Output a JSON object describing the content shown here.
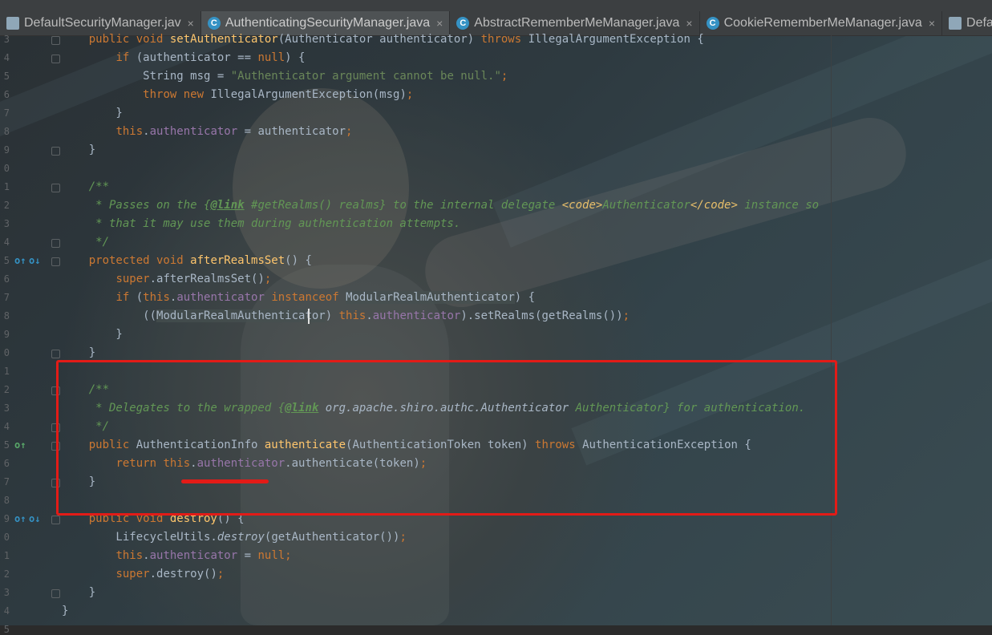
{
  "tabs": [
    {
      "label": "DefaultSecurityManager.jav",
      "icon": "doc-icon",
      "active": false
    },
    {
      "label": "AuthenticatingSecurityManager.java",
      "icon": "class-icon",
      "active": true
    },
    {
      "label": "AbstractRememberMeManager.java",
      "icon": "class-icon",
      "active": false
    },
    {
      "label": "CookieRememberMeManager.java",
      "icon": "class-icon",
      "active": false
    },
    {
      "label": "DefaultSecu",
      "icon": "doc-icon",
      "active": false
    }
  ],
  "close_glyph": "×",
  "gutter": {
    "line_numbers": [
      "3",
      "4",
      "5",
      "6",
      "7",
      "8",
      "9",
      "0",
      "1",
      "2",
      "3",
      "4",
      "5",
      "6",
      "7",
      "8",
      "9",
      "0",
      "1",
      "2",
      "3",
      "4",
      "5",
      "6",
      "7",
      "8",
      "9",
      "0",
      "1",
      "2",
      "3",
      "4",
      "5"
    ]
  },
  "code_lines": [
    "    public void setAuthenticator(Authenticator authenticator) throws IllegalArgumentException {",
    "        if (authenticator == null) {",
    "            String msg = \"Authenticator argument cannot be null.\";",
    "            throw new IllegalArgumentException(msg);",
    "        }",
    "        this.authenticator = authenticator;",
    "    }",
    "",
    "    /**",
    "     * Passes on the {@link #getRealms() realms} to the internal delegate <code>Authenticator</code> instance so",
    "     * that it may use them during authentication attempts.",
    "     */",
    "    protected void afterRealmsSet() {",
    "        super.afterRealmsSet();",
    "        if (this.authenticator instanceof ModularRealmAuthenticator) {",
    "            ((ModularRealmAuthenticator) this.authenticator).setRealms(getRealms());",
    "        }",
    "    }",
    "",
    "    /**",
    "     * Delegates to the wrapped {@link org.apache.shiro.authc.Authenticator Authenticator} for authentication.",
    "     */",
    "    public AuthenticationInfo authenticate(AuthenticationToken token) throws AuthenticationException {",
    "        return this.authenticator.authenticate(token);",
    "    }",
    "",
    "    public void destroy() {",
    "        LifecycleUtils.destroy(getAuthenticator());",
    "        this.authenticator = null;",
    "        super.destroy();",
    "    }",
    "}"
  ]
}
